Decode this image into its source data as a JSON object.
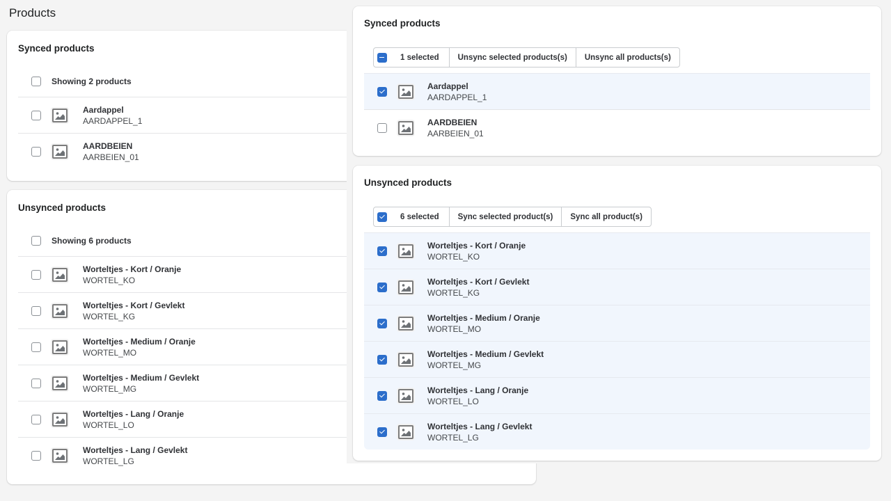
{
  "page": {
    "title": "Products"
  },
  "left": {
    "synced": {
      "title": "Synced products",
      "header_label": "Showing 2 products",
      "items": [
        {
          "name": "Aardappel",
          "sku": "AARDAPPEL_1",
          "checked": false
        },
        {
          "name": "AARDBEIEN",
          "sku": "AARBEIEN_01",
          "checked": false
        }
      ]
    },
    "unsynced": {
      "title": "Unsynced products",
      "header_label": "Showing 6 products",
      "items": [
        {
          "name": "Worteltjes - Kort / Oranje",
          "sku": "WORTEL_KO",
          "checked": false
        },
        {
          "name": "Worteltjes - Kort / Gevlekt",
          "sku": "WORTEL_KG",
          "checked": false
        },
        {
          "name": "Worteltjes - Medium / Oranje",
          "sku": "WORTEL_MO",
          "checked": false
        },
        {
          "name": "Worteltjes - Medium / Gevlekt",
          "sku": "WORTEL_MG",
          "checked": false
        },
        {
          "name": "Worteltjes - Lang / Oranje",
          "sku": "WORTEL_LO",
          "checked": false
        },
        {
          "name": "Worteltjes - Lang / Gevlekt",
          "sku": "WORTEL_LG",
          "checked": false
        }
      ]
    }
  },
  "right": {
    "synced": {
      "title": "Synced products",
      "selection_state": "indeterminate",
      "selected_label": "1 selected",
      "actions": [
        "Unsync selected products(s)",
        "Unsync all products(s)"
      ],
      "items": [
        {
          "name": "Aardappel",
          "sku": "AARDAPPEL_1",
          "checked": true
        },
        {
          "name": "AARDBEIEN",
          "sku": "AARBEIEN_01",
          "checked": false
        }
      ]
    },
    "unsynced": {
      "title": "Unsynced products",
      "selection_state": "checked",
      "selected_label": "6 selected",
      "actions": [
        "Sync selected product(s)",
        "Sync all product(s)"
      ],
      "items": [
        {
          "name": "Worteltjes - Kort / Oranje",
          "sku": "WORTEL_KO",
          "checked": true
        },
        {
          "name": "Worteltjes - Kort / Gevlekt",
          "sku": "WORTEL_KG",
          "checked": true
        },
        {
          "name": "Worteltjes - Medium / Oranje",
          "sku": "WORTEL_MO",
          "checked": true
        },
        {
          "name": "Worteltjes - Medium / Gevlekt",
          "sku": "WORTEL_MG",
          "checked": true
        },
        {
          "name": "Worteltjes - Lang / Oranje",
          "sku": "WORTEL_LO",
          "checked": true
        },
        {
          "name": "Worteltjes - Lang / Gevlekt",
          "sku": "WORTEL_LG",
          "checked": true
        }
      ]
    }
  },
  "icons": {
    "product_thumbnail": "image-placeholder-icon"
  },
  "colors": {
    "accent": "#2c6ecb",
    "selected_row_bg": "#f1f6fd",
    "page_bg": "#f4f4f4"
  }
}
